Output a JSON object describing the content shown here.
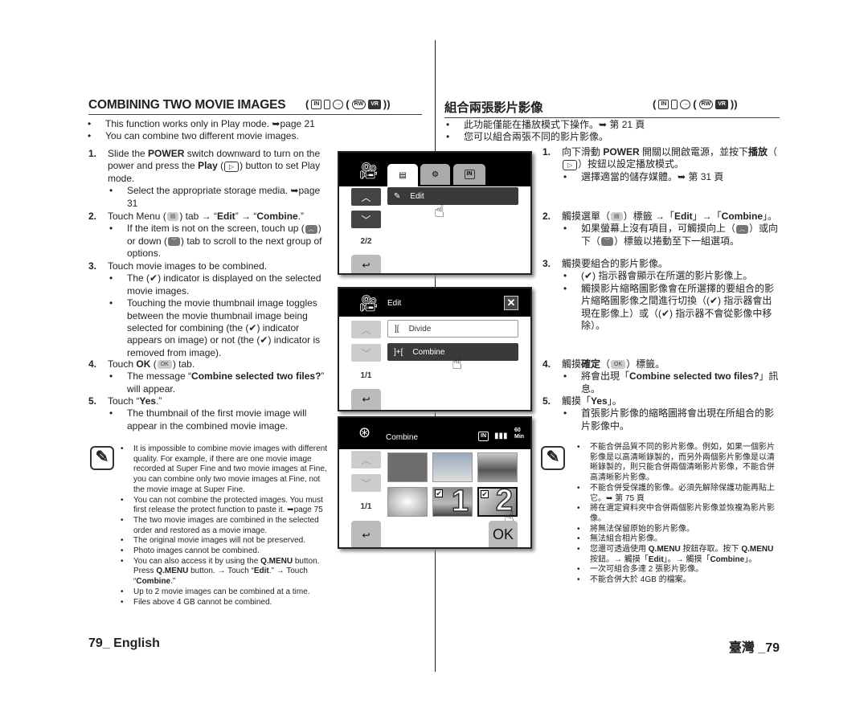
{
  "left": {
    "heading": "COMBINING TWO MOVIE IMAGES",
    "modes": [
      "IN",
      "card",
      "disc",
      "RW",
      "VR"
    ],
    "intro": [
      "This function works only in Play mode. ➥page 21",
      "You can combine two different movie images."
    ],
    "steps": [
      {
        "num": "1.",
        "text": [
          {
            "t": "Slide the "
          },
          {
            "t": "POWER",
            "b": 1
          },
          {
            "t": " switch downward to turn on the power and press the "
          },
          {
            "t": "Play",
            "b": 1
          },
          {
            "t": " ("
          },
          {
            "icon": "play-icon",
            "t": "▷"
          },
          {
            "t": ") button to set Play mode."
          }
        ],
        "subs": [
          [
            {
              "t": "Select the appropriate storage media. ➥page 31"
            }
          ]
        ]
      },
      {
        "num": "2.",
        "text": [
          {
            "t": "Touch Menu ("
          },
          {
            "icon": "menu-icon",
            "t": "▤"
          },
          {
            "t": ") tab → “"
          },
          {
            "t": "Edit",
            "b": 1
          },
          {
            "t": "” → “"
          },
          {
            "t": "Combine",
            "b": 1
          },
          {
            "t": ".”"
          }
        ],
        "subs": [
          [
            {
              "t": "If the item is not on the screen, touch up ("
            },
            {
              "icon": "up-tab-icon",
              "t": "︿"
            },
            {
              "t": ") or down ("
            },
            {
              "icon": "down-tab-icon",
              "t": "﹀"
            },
            {
              "t": ") tab to scroll to the next group of options."
            }
          ]
        ]
      },
      {
        "num": "3.",
        "text": [
          {
            "t": "Touch movie images to be combined."
          }
        ],
        "subs": [
          [
            {
              "t": "The (✔) indicator is displayed on the selected movie images."
            }
          ],
          [
            {
              "t": "Touching the movie thumbnail image toggles between the movie thumbnail image being selected for combining (the (✔) indicator appears on image) or not (the (✔) indicator is removed from image)."
            }
          ]
        ]
      },
      {
        "num": "4.",
        "text": [
          {
            "t": "Touch "
          },
          {
            "t": "OK",
            "b": 1
          },
          {
            "t": " ("
          },
          {
            "icon": "ok-tab-icon",
            "t": "OK"
          },
          {
            "t": ") tab."
          }
        ],
        "subs": [
          [
            {
              "t": "The message “"
            },
            {
              "t": "Combine selected two files?",
              "b": 1
            },
            {
              "t": "” will appear."
            }
          ]
        ]
      },
      {
        "num": "5.",
        "text": [
          {
            "t": "Touch “"
          },
          {
            "t": "Yes",
            "b": 1
          },
          {
            "t": ".”"
          }
        ],
        "subs": [
          [
            {
              "t": "The thumbnail of the first movie image will appear in the combined movie image."
            }
          ]
        ]
      }
    ],
    "notes": [
      [
        {
          "t": "It is impossible to combine movie images with different quality. For example, if there are one movie image recorded at Super Fine and two movie images at Fine, you can combine only two movie images at Fine, not the movie image at Super Fine."
        }
      ],
      [
        {
          "t": "You can not combine the protected images. You must first release the protect function to paste it. ➥page 75"
        }
      ],
      [
        {
          "t": "The two movie images are combined in the selected order and restored as a movie image."
        }
      ],
      [
        {
          "t": "The original movie images will not be preserved."
        }
      ],
      [
        {
          "t": "Photo images cannot be combined."
        }
      ],
      [
        {
          "t": "You can also access it by using the "
        },
        {
          "t": "Q.MENU",
          "b": 1
        },
        {
          "t": " button. Press "
        },
        {
          "t": "Q.MENU",
          "b": 1
        },
        {
          "t": " button. → Touch “"
        },
        {
          "t": "Edit",
          "b": 1
        },
        {
          "t": ".” → Touch “"
        },
        {
          "t": "Combine",
          "b": 1
        },
        {
          "t": ".”"
        }
      ],
      [
        {
          "t": "Up to 2 movie images can be combined at a time."
        }
      ],
      [
        {
          "t": "Files above 4 GB cannot be combined."
        }
      ]
    ],
    "footer": "79_ English"
  },
  "right": {
    "heading": "組合兩張影片影像",
    "intro": [
      "此功能僅能在播放模式下操作。➥ 第 21 頁",
      "您可以組合兩張不同的影片影像。"
    ],
    "steps": [
      {
        "num": "1.",
        "text": [
          {
            "t": "向下滑動 "
          },
          {
            "t": "POWER",
            "b": 1
          },
          {
            "t": " 開關以開啟電源，並按下"
          },
          {
            "t": "播放",
            "b": 1
          },
          {
            "t": "（"
          },
          {
            "icon": "play-icon",
            "t": "▷"
          },
          {
            "t": "）按鈕以設定播放模式。"
          }
        ],
        "subs": [
          [
            {
              "t": "選擇適當的儲存媒體。➥ 第 31 頁"
            }
          ]
        ]
      },
      {
        "num": "2.",
        "text": [
          {
            "t": "觸摸選單（"
          },
          {
            "icon": "menu-icon",
            "t": "▤"
          },
          {
            "t": "）標籤 →「"
          },
          {
            "t": "Edit",
            "b": 1
          },
          {
            "t": "」→「"
          },
          {
            "t": "Combine",
            "b": 1
          },
          {
            "t": "」。"
          }
        ],
        "subs": [
          [
            {
              "t": "如果螢幕上沒有項目，可觸摸向上（"
            },
            {
              "icon": "up-tab-icon",
              "t": "︿"
            },
            {
              "t": "）或向下（"
            },
            {
              "icon": "down-tab-icon",
              "t": "﹀"
            },
            {
              "t": "）標籤以捲動至下一組選項。"
            }
          ]
        ]
      },
      {
        "num": "3.",
        "text": [
          {
            "t": "觸摸要組合的影片影像。"
          }
        ],
        "subs": [
          [
            {
              "t": "(✔) 指示器會顯示在所選的影片影像上。"
            }
          ],
          [
            {
              "t": "觸摸影片縮略圖影像會在所選擇的要組合的影片縮略圖影像之間進行切換（(✔) 指示器會出現在影像上）或（(✔) 指示器不會從影像中移除）。"
            }
          ]
        ]
      },
      {
        "num": "4.",
        "text": [
          {
            "t": "觸摸"
          },
          {
            "t": "確定",
            "b": 1
          },
          {
            "t": "（"
          },
          {
            "icon": "ok-tab-icon",
            "t": "OK"
          },
          {
            "t": "）標籤。"
          }
        ],
        "subs": [
          [
            {
              "t": "將會出現「"
            },
            {
              "t": "Combine selected two files?",
              "b": 1
            },
            {
              "t": "」訊息。"
            }
          ]
        ]
      },
      {
        "num": "5.",
        "text": [
          {
            "t": "觸摸「"
          },
          {
            "t": "Yes",
            "b": 1
          },
          {
            "t": "」。"
          }
        ],
        "subs": [
          [
            {
              "t": "首張影片影像的縮略圖將會出現在所組合的影片影像中。"
            }
          ]
        ]
      }
    ],
    "notes": [
      [
        {
          "t": "不能合併品質不同的影片影像。例如，如果一個影片影像是以高清晰錄製的，而另外兩個影片影像是以清晰錄製的，則只能合併兩個清晰影片影像，不能合併高清晰影片影像。"
        }
      ],
      [
        {
          "t": "不能合併受保護的影像。必須先解除保護功能再貼上它。➥ 第 75 頁"
        }
      ],
      [
        {
          "t": "將在選定資料夾中合併兩個影片影像並恢複為影片影像。"
        }
      ],
      [
        {
          "t": "將無法保留原始的影片影像。"
        }
      ],
      [
        {
          "t": "無法組合相片影像。"
        }
      ],
      [
        {
          "t": "您還可透過使用 "
        },
        {
          "t": "Q.MENU",
          "b": 1
        },
        {
          "t": " 按鈕存取。按下 "
        },
        {
          "t": "Q.MENU",
          "b": 1
        },
        {
          "t": " 按鈕。→ 觸摸「"
        },
        {
          "t": "Edit",
          "b": 1
        },
        {
          "t": "」。→ 觸摸「"
        },
        {
          "t": "Combine",
          "b": 1
        },
        {
          "t": "」。"
        }
      ],
      [
        {
          "t": "一次可組合多達 2 張影片影像。"
        }
      ],
      [
        {
          "t": "不能合併大於 4GB 的檔案。"
        }
      ]
    ],
    "footer": "臺灣 _79"
  },
  "screens": {
    "menu": {
      "tab_storage": "IN",
      "item": "Edit",
      "page": "2/2"
    },
    "edit": {
      "title": "Edit",
      "items": [
        "Divide",
        "Combine"
      ],
      "page": "1/1"
    },
    "combine": {
      "title": "Combine",
      "storage": "IN",
      "remaining": "60",
      "remaining_unit": "Min",
      "page": "1/1",
      "ok": "OK",
      "selected": [
        "1",
        "2"
      ]
    }
  }
}
